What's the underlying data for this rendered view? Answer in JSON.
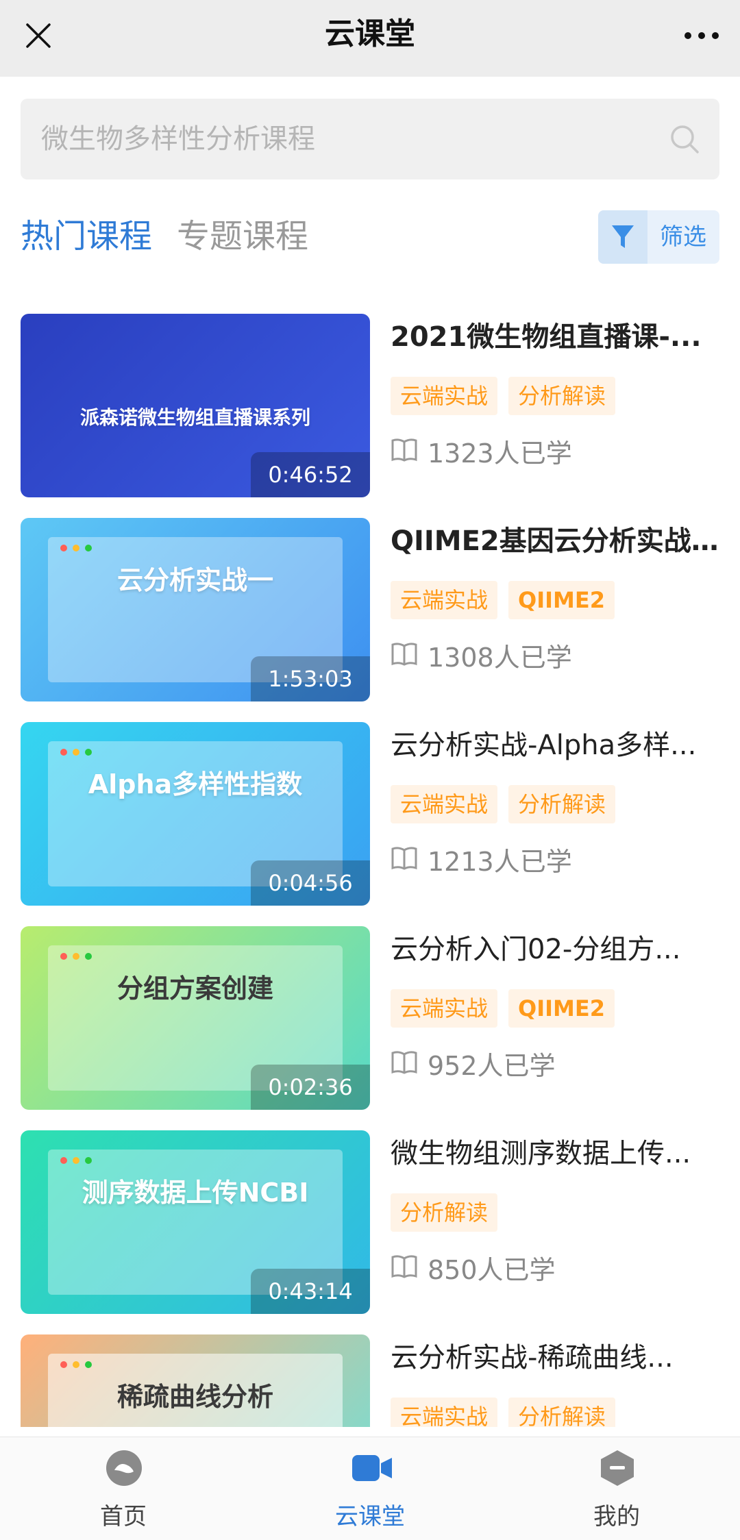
{
  "header": {
    "title": "云课堂",
    "close_icon": "close-icon",
    "more_icon": "more-icon"
  },
  "search": {
    "placeholder": "微生物多样性分析课程",
    "icon": "search-icon"
  },
  "tabs": [
    {
      "label": "热门课程",
      "active": true
    },
    {
      "label": "专题课程",
      "active": false
    }
  ],
  "filter": {
    "label": "筛选",
    "icon": "filter-icon"
  },
  "colors": {
    "accent": "#2f7bd6",
    "tag_bg": "#fff3e6",
    "tag_text": "#ff9a1a"
  },
  "courses": [
    {
      "title": "2021微生物组直播课-...",
      "thumb_text": "派森诺微生物组直播课系列",
      "duration": "0:46:52",
      "tags": [
        "云端实战",
        "分析解读"
      ],
      "learners": "1323人已学"
    },
    {
      "title": "QIIME2基因云分析实战...",
      "thumb_text": "云分析实战一",
      "duration": "1:53:03",
      "tags": [
        "云端实战",
        "QIIME2"
      ],
      "learners": "1308人已学"
    },
    {
      "title": "云分析实战-Alpha多样...",
      "thumb_text": "Alpha多样性指数",
      "duration": "0:04:56",
      "tags": [
        "云端实战",
        "分析解读"
      ],
      "learners": "1213人已学"
    },
    {
      "title": "云分析入门02-分组方...",
      "thumb_text": "分组方案创建",
      "duration": "0:02:36",
      "tags": [
        "云端实战",
        "QIIME2"
      ],
      "learners": "952人已学"
    },
    {
      "title": "微生物组测序数据上传...",
      "thumb_text": "测序数据上传NCBI",
      "duration": "0:43:14",
      "tags": [
        "分析解读"
      ],
      "learners": "850人已学"
    },
    {
      "title": "云分析实战-稀疏曲线...",
      "thumb_text": "稀疏曲线分析",
      "duration": "",
      "tags": [
        "云端实战",
        "分析解读"
      ],
      "learners": ""
    }
  ],
  "bottom_nav": [
    {
      "label": "首页",
      "icon": "home-icon",
      "active": false
    },
    {
      "label": "云课堂",
      "icon": "video-icon",
      "active": true
    },
    {
      "label": "我的",
      "icon": "profile-icon",
      "active": false
    }
  ]
}
